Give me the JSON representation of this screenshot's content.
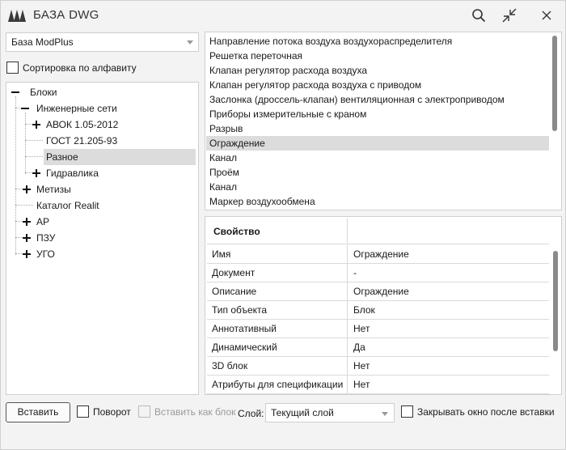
{
  "window": {
    "title": "БАЗА DWG",
    "icons": [
      "logo-icon",
      "search-icon",
      "collapse-icon",
      "close-icon"
    ]
  },
  "base_selector": {
    "value": "База ModPlus"
  },
  "sort_alpha": {
    "label": "Сортировка по алфавиту",
    "checked": false
  },
  "tree": {
    "items": [
      {
        "label": "Блоки",
        "level": 0,
        "expander": "minus"
      },
      {
        "label": "Инженерные сети",
        "level": 1,
        "expander": "minus"
      },
      {
        "label": "АВОК 1.05-2012",
        "level": 2,
        "expander": "plus"
      },
      {
        "label": "ГОСТ 21.205-93",
        "level": 2,
        "expander": "none"
      },
      {
        "label": "Разное",
        "level": 2,
        "expander": "none",
        "selected": true
      },
      {
        "label": "Гидравлика",
        "level": 2,
        "expander": "plus"
      },
      {
        "label": "Метизы",
        "level": 1,
        "expander": "plus"
      },
      {
        "label": "Каталог Realit",
        "level": 1,
        "expander": "none"
      },
      {
        "label": "АР",
        "level": 1,
        "expander": "plus"
      },
      {
        "label": "ПЗУ",
        "level": 1,
        "expander": "plus"
      },
      {
        "label": "УГО",
        "level": 1,
        "expander": "plus"
      }
    ]
  },
  "block_list": {
    "items": [
      "Направление потока воздуха воздухораспределителя",
      "Решетка переточная",
      "Клапан регулятор расхода воздуха",
      "Клапан регулятор расхода воздуха с приводом",
      "Заслонка (дроссель-клапан) вентиляционная с электроприводом",
      "Приборы измерительные с краном",
      "Разрыв",
      "Ограждение",
      "Канал",
      "Проём",
      "Канал",
      "Маркер воздухообмена"
    ],
    "selected": "Ограждение"
  },
  "properties": {
    "header": "Свойство",
    "rows": [
      {
        "key": "Имя",
        "value": "Ограждение"
      },
      {
        "key": "Документ",
        "value": "-"
      },
      {
        "key": "Описание",
        "value": "Ограждение"
      },
      {
        "key": "Тип объекта",
        "value": "Блок"
      },
      {
        "key": "Аннотативный",
        "value": "Нет"
      },
      {
        "key": "Динамический",
        "value": "Да"
      },
      {
        "key": "3D блок",
        "value": "Нет"
      },
      {
        "key": "Атрибуты для спецификации",
        "value": "Нет"
      }
    ]
  },
  "bottom": {
    "insert_button": "Вставить",
    "rotate": {
      "label": "Поворот",
      "checked": false
    },
    "insert_as_block": {
      "label": "Вставить как блок",
      "checked": false,
      "disabled": true
    },
    "layer_label": "Слой:",
    "layer_value": "Текущий слой",
    "close_after_insert": {
      "label": "Закрывать окно после вставки",
      "checked": false
    }
  }
}
